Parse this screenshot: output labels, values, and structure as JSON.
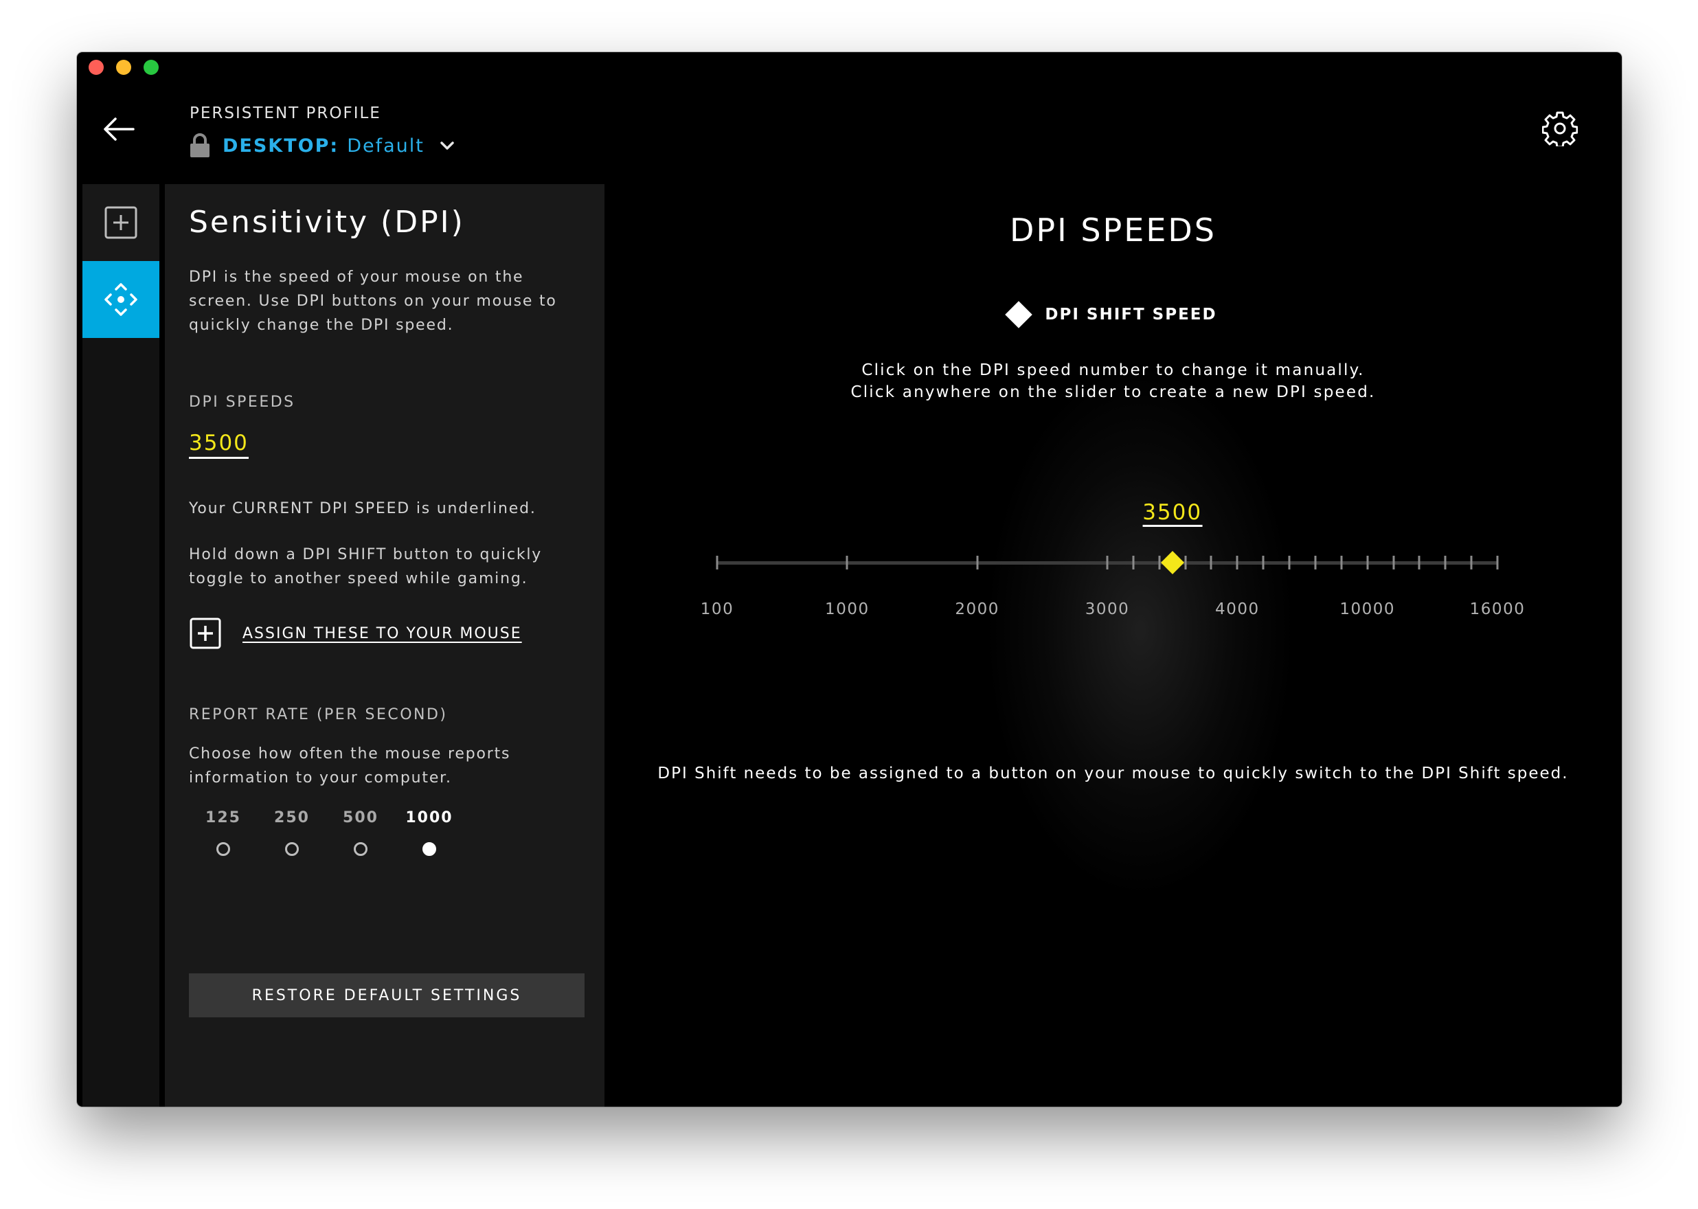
{
  "header": {
    "profile_label": "PERSISTENT PROFILE",
    "profile_key": "DESKTOP:",
    "profile_value": "Default"
  },
  "sidebar": {
    "items": [
      {
        "icon": "add-box-icon",
        "active": false
      },
      {
        "icon": "dpi-move-icon",
        "active": true
      }
    ],
    "accent": "#00a9e0"
  },
  "panel": {
    "title": "Sensitivity (DPI)",
    "intro": "DPI is the speed of your mouse on the screen. Use DPI buttons on your mouse to quickly change the DPI speed.",
    "dpi_heading": "DPI SPEEDS",
    "current_dpi": "3500",
    "current_note": "Your CURRENT DPI SPEED is underlined.",
    "shift_note": "Hold down a DPI SHIFT button to quickly toggle to another speed while gaming.",
    "assign_link": "ASSIGN THESE TO YOUR MOUSE",
    "report_heading": "REPORT RATE (PER SECOND)",
    "report_desc": "Choose how often the mouse reports information to your computer.",
    "report_rates": [
      "125",
      "250",
      "500",
      "1000"
    ],
    "selected_rate": "1000",
    "restore_button": "RESTORE DEFAULT SETTINGS"
  },
  "main": {
    "title": "DPI SPEEDS",
    "legend": "DPI SHIFT SPEED",
    "hint_1": "Click on the DPI speed number to change it manually.",
    "hint_2": "Click anywhere on the slider to create a new DPI speed.",
    "selected_value": "3500",
    "note": "DPI Shift needs to be assigned to a button on your mouse to quickly switch to the DPI Shift speed.",
    "slider": {
      "labels": [
        "100",
        "1000",
        "2000",
        "3000",
        "4000",
        "10000",
        "16000"
      ],
      "label_index": [
        0,
        1,
        2,
        3,
        4,
        5,
        6
      ],
      "tick_count": 19,
      "thumb_position": 3.5,
      "thumb_color": "#f4e71a"
    }
  }
}
